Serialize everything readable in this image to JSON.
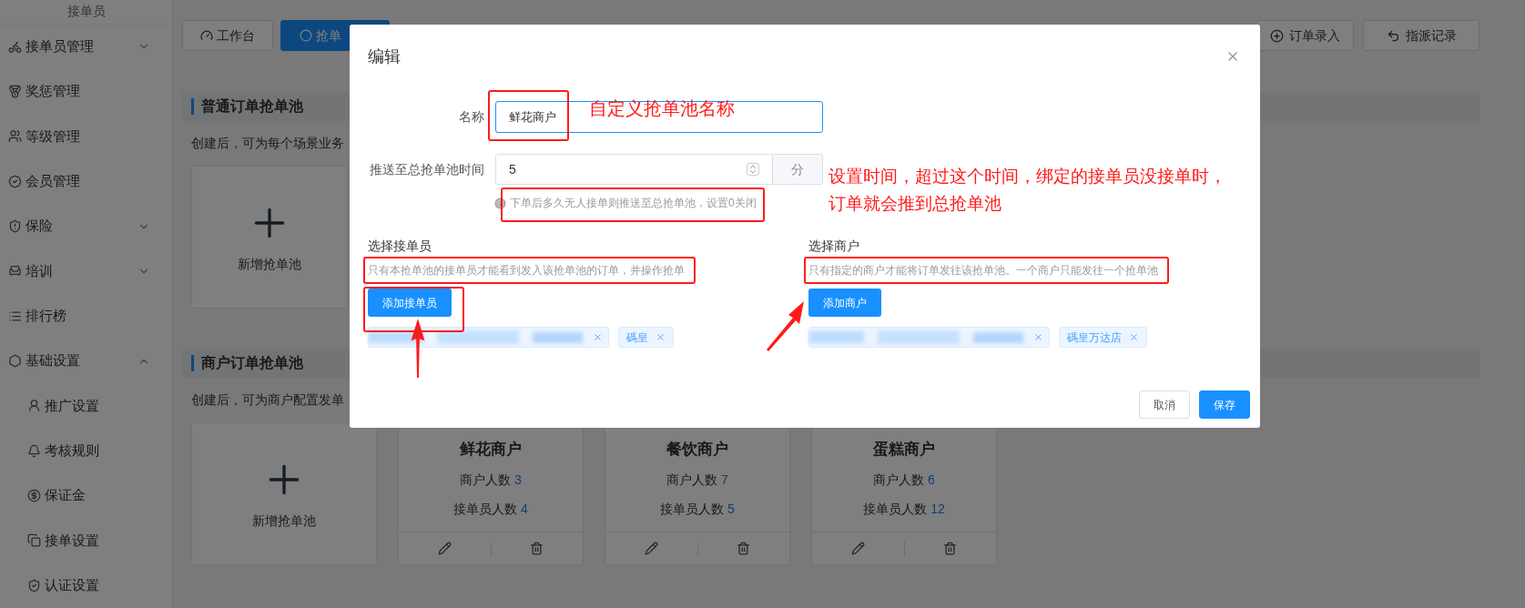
{
  "sidebar": {
    "title": "接单员",
    "items": [
      {
        "label": "接单员管理",
        "kind": "group",
        "expanded": false
      },
      {
        "label": "奖惩管理",
        "kind": "link"
      },
      {
        "label": "等级管理",
        "kind": "link"
      },
      {
        "label": "会员管理",
        "kind": "link"
      },
      {
        "label": "保险",
        "kind": "group",
        "expanded": false
      },
      {
        "label": "培训",
        "kind": "group",
        "expanded": false
      },
      {
        "label": "排行榜",
        "kind": "link"
      },
      {
        "label": "基础设置",
        "kind": "group",
        "expanded": true,
        "children": [
          {
            "label": "推广设置"
          },
          {
            "label": "考核规则"
          },
          {
            "label": "保证金"
          },
          {
            "label": "接单设置"
          },
          {
            "label": "认证设置"
          }
        ]
      }
    ]
  },
  "top_tabs": [
    {
      "label": "工作台",
      "selected": false
    },
    {
      "label": "抢单",
      "selected": true
    }
  ],
  "top_actions": [
    {
      "label": "订单录入"
    },
    {
      "label": "指派记录"
    }
  ],
  "sections": [
    {
      "title": "普通订单抢单池",
      "description": "创建后，可为每个场景业务",
      "cards": [
        {
          "kind": "add",
          "label": "新增抢单池"
        }
      ]
    },
    {
      "title": "商户订单抢单池",
      "description": "创建后，可为商户配置发单",
      "cards": [
        {
          "kind": "add",
          "label": "新增抢单池"
        },
        {
          "kind": "pool",
          "name": "鲜花商户",
          "merchant_label": "商户人数",
          "merchant_count": "3",
          "rider_label": "接单员人数",
          "rider_count": "4"
        },
        {
          "kind": "pool",
          "name": "餐饮商户",
          "merchant_label": "商户人数",
          "merchant_count": "7",
          "rider_label": "接单员人数",
          "rider_count": "5"
        },
        {
          "kind": "pool",
          "name": "蛋糕商户",
          "merchant_label": "商户人数",
          "merchant_count": "6",
          "rider_label": "接单员人数",
          "rider_count": "12"
        }
      ]
    }
  ],
  "dialog": {
    "title": "编辑",
    "name_field": {
      "label": "名称",
      "value": "鲜花商户"
    },
    "time_field": {
      "label": "推送至总抢单池时间",
      "value": "5",
      "unit": "分",
      "hint": "下单后多久无人接单则推送至总抢单池，设置0关闭"
    },
    "riders": {
      "title": "选择接单员",
      "description": "只有本抢单池的接单员才能看到发入该抢单池的订单，并操作抢单",
      "button": "添加接单员",
      "tags": [
        {
          "kind": "blurred"
        },
        {
          "kind": "tag",
          "label": "碼皇"
        }
      ]
    },
    "merchants": {
      "title": "选择商户",
      "description": "只有指定的商户才能将订单发往该抢单池。一个商户只能发往一个抢单池",
      "button": "添加商户",
      "tags": [
        {
          "kind": "blurred"
        },
        {
          "kind": "tag",
          "label": "碼皇万达店"
        }
      ]
    },
    "buttons": [
      {
        "label": "取消",
        "kind": "secondary"
      },
      {
        "label": "保存",
        "kind": "primary"
      }
    ]
  },
  "annotations": {
    "name_note": "自定义抢单池名称",
    "time_note": [
      "设置时间，超过这个时间，绑定的接单员没接单时，",
      "订单就会推到总抢单池"
    ]
  }
}
